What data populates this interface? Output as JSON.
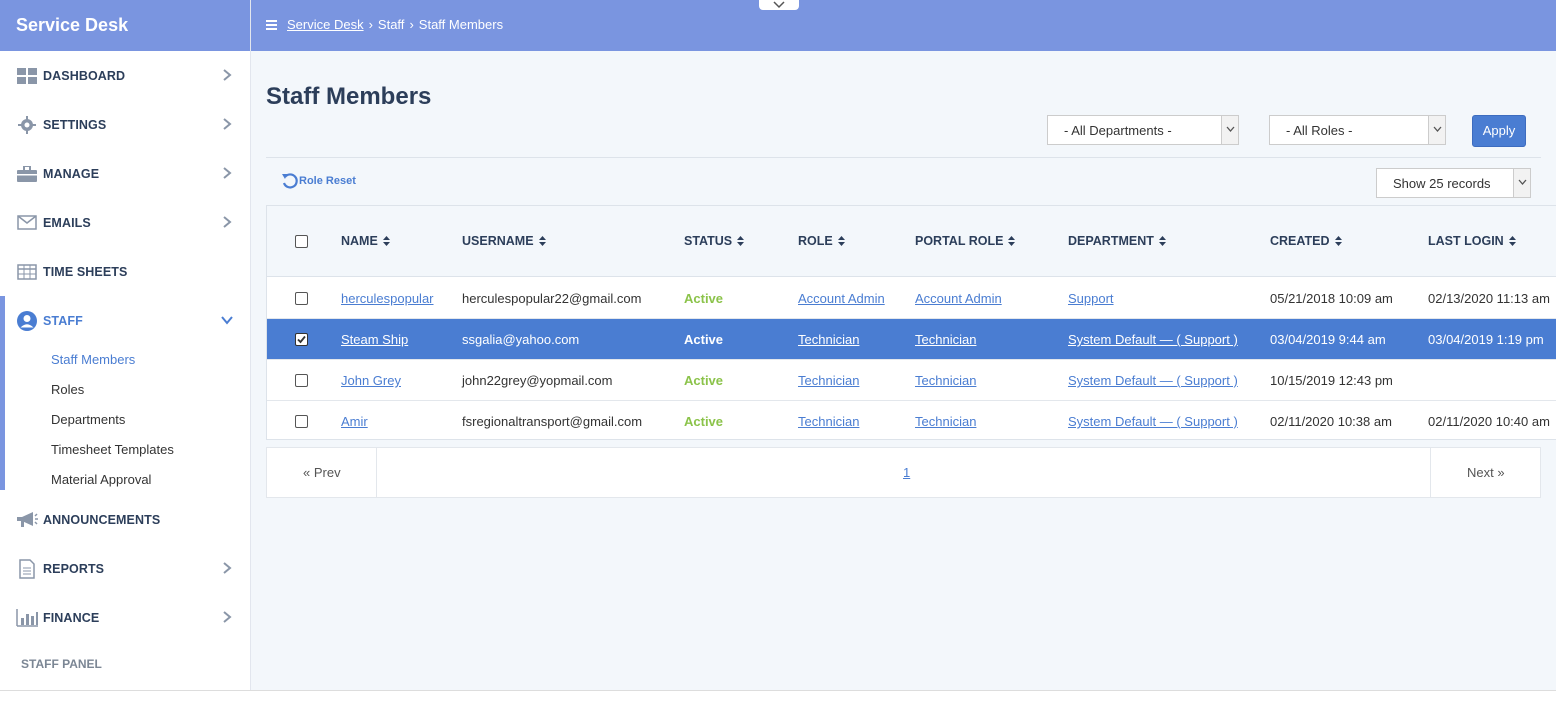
{
  "brand": "Service Desk",
  "breadcrumb": {
    "root": "Service Desk",
    "section": "Staff",
    "current": "Staff Members"
  },
  "sidebar": {
    "items": [
      {
        "label": "DASHBOARD",
        "icon": "dashboard-icon"
      },
      {
        "label": "SETTINGS",
        "icon": "gear-icon"
      },
      {
        "label": "MANAGE",
        "icon": "briefcase-icon"
      },
      {
        "label": "EMAILS",
        "icon": "envelope-icon"
      },
      {
        "label": "TIME SHEETS",
        "icon": "table-icon"
      },
      {
        "label": "STAFF",
        "icon": "user-icon"
      },
      {
        "label": "ANNOUNCEMENTS",
        "icon": "megaphone-icon"
      },
      {
        "label": "REPORTS",
        "icon": "document-icon"
      },
      {
        "label": "FINANCE",
        "icon": "bar-chart-icon"
      }
    ],
    "staff_sub": [
      "Staff Members",
      "Roles",
      "Departments",
      "Timesheet Templates",
      "Material Approval"
    ],
    "footer": "STAFF PANEL"
  },
  "main": {
    "title": "Staff Members",
    "department_select": "- All Departments -",
    "role_select": "- All Roles -",
    "apply_label": "Apply",
    "role_reset_label": "Role Reset",
    "records_select": "Show 25 records"
  },
  "table": {
    "headers": [
      "NAME",
      "USERNAME",
      "STATUS",
      "ROLE",
      "PORTAL ROLE",
      "DEPARTMENT",
      "CREATED",
      "LAST LOGIN"
    ],
    "rows": [
      {
        "checked": false,
        "name": "herculespopular",
        "username": "herculespopular22@gmail.com",
        "status": "Active",
        "role": "Account Admin",
        "portal_role": "Account Admin",
        "department": "Support",
        "created": "05/21/2018 10:09 am",
        "last_login": "02/13/2020 11:13 am"
      },
      {
        "checked": true,
        "name": "Steam Ship",
        "username": "ssgalia@yahoo.com",
        "status": "Active",
        "role": "Technician",
        "portal_role": "Technician",
        "department": "System Default — ( Support )",
        "created": "03/04/2019 9:44 am",
        "last_login": "03/04/2019 1:19 pm"
      },
      {
        "checked": false,
        "name": "John Grey",
        "username": "john22grey@yopmail.com",
        "status": "Active",
        "role": "Technician",
        "portal_role": "Technician",
        "department": "System Default — ( Support )",
        "created": "10/15/2019 12:43 pm",
        "last_login": ""
      },
      {
        "checked": false,
        "name": "Amir",
        "username": "fsregionaltransport@gmail.com",
        "status": "Active",
        "role": "Technician",
        "portal_role": "Technician",
        "department": "System Default — ( Support )",
        "created": "02/11/2020 10:38 am",
        "last_login": "02/11/2020 10:40 am"
      }
    ]
  },
  "pagination": {
    "prev": "« Prev",
    "page": "1",
    "next": "Next »"
  },
  "colors": {
    "accent": "#7a95e0",
    "primary": "#4a7dd2",
    "active_status": "#8bc34a"
  }
}
